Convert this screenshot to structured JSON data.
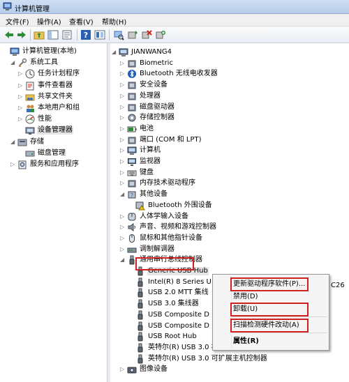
{
  "window": {
    "title": "计算机管理"
  },
  "menu": [
    "文件(F)",
    "操作(A)",
    "查看(V)",
    "帮助(H)"
  ],
  "left_tree": [
    {
      "label": "计算机管理(本地)",
      "icon": "computer-mgmt-icon",
      "arrow": "",
      "level": 0
    },
    {
      "label": "系统工具",
      "icon": "tools-icon",
      "arrow": "◢",
      "level": 1
    },
    {
      "label": "任务计划程序",
      "icon": "clock-icon",
      "arrow": "▷",
      "level": 2
    },
    {
      "label": "事件查看器",
      "icon": "event-viewer-icon",
      "arrow": "▷",
      "level": 2
    },
    {
      "label": "共享文件夹",
      "icon": "shared-folder-icon",
      "arrow": "▷",
      "level": 2
    },
    {
      "label": "本地用户和组",
      "icon": "users-icon",
      "arrow": "▷",
      "level": 2
    },
    {
      "label": "性能",
      "icon": "performance-icon",
      "arrow": "▷",
      "level": 2
    },
    {
      "label": "设备管理器",
      "icon": "device-manager-icon",
      "arrow": "",
      "level": 2,
      "selected": true
    },
    {
      "label": "存储",
      "icon": "storage-icon",
      "arrow": "◢",
      "level": 1
    },
    {
      "label": "磁盘管理",
      "icon": "disk-mgmt-icon",
      "arrow": "",
      "level": 2
    },
    {
      "label": "服务和应用程序",
      "icon": "services-icon",
      "arrow": "▷",
      "level": 1
    }
  ],
  "device_tree": [
    {
      "label": "JIANWANG4",
      "icon": "computer-icon",
      "arrow": "◢",
      "level": 0
    },
    {
      "label": "Biometric",
      "icon": "device-icon",
      "arrow": "▷",
      "level": 1
    },
    {
      "label": "Bluetooth 无线电收发器",
      "icon": "bluetooth-icon",
      "arrow": "▷",
      "level": 1
    },
    {
      "label": "安全设备",
      "icon": "device-icon",
      "arrow": "▷",
      "level": 1
    },
    {
      "label": "处理器",
      "icon": "device-icon",
      "arrow": "▷",
      "level": 1
    },
    {
      "label": "磁盘驱动器",
      "icon": "device-icon",
      "arrow": "▷",
      "level": 1
    },
    {
      "label": "存储控制器",
      "icon": "gear-icon",
      "arrow": "▷",
      "level": 1
    },
    {
      "label": "电池",
      "icon": "battery-icon",
      "arrow": "▷",
      "level": 1
    },
    {
      "label": "端口 (COM 和 LPT)",
      "icon": "device-icon",
      "arrow": "▷",
      "level": 1
    },
    {
      "label": "计算机",
      "icon": "computer-icon",
      "arrow": "▷",
      "level": 1
    },
    {
      "label": "监视器",
      "icon": "monitor-icon",
      "arrow": "▷",
      "level": 1
    },
    {
      "label": "键盘",
      "icon": "keyboard-icon",
      "arrow": "▷",
      "level": 1
    },
    {
      "label": "内存技术驱动程序",
      "icon": "device-icon",
      "arrow": "▷",
      "level": 1
    },
    {
      "label": "其他设备",
      "icon": "other-devices-icon",
      "arrow": "◢",
      "level": 1
    },
    {
      "label": "Bluetooth 外围设备",
      "icon": "warning-device-icon",
      "arrow": "",
      "level": 2
    },
    {
      "label": "人体学输入设备",
      "icon": "hid-icon",
      "arrow": "▷",
      "level": 1
    },
    {
      "label": "声音、视频和游戏控制器",
      "icon": "sound-icon",
      "arrow": "▷",
      "level": 1
    },
    {
      "label": "鼠标和其他指针设备",
      "icon": "mouse-icon",
      "arrow": "▷",
      "level": 1
    },
    {
      "label": "调制解调器",
      "icon": "modem-icon",
      "arrow": "▷",
      "level": 1
    },
    {
      "label": "通用串行总线控制器",
      "icon": "usb-icon",
      "arrow": "◢",
      "level": 1,
      "highlight": true
    },
    {
      "label": "Generic USB Hub",
      "icon": "usb-icon",
      "arrow": "",
      "level": 2,
      "selected": true
    },
    {
      "label": "Intel(R) 8 Series U",
      "icon": "usb-icon",
      "arrow": "",
      "level": 2
    },
    {
      "label": "USB 2.0 MTT 集线",
      "icon": "usb-icon",
      "arrow": "",
      "level": 2
    },
    {
      "label": "USB 3.0 集线器",
      "icon": "usb-icon",
      "arrow": "",
      "level": 2
    },
    {
      "label": "USB Composite D",
      "icon": "usb-icon",
      "arrow": "",
      "level": 2
    },
    {
      "label": "USB Composite D",
      "icon": "usb-icon",
      "arrow": "",
      "level": 2
    },
    {
      "label": "USB Root Hub",
      "icon": "usb-icon",
      "arrow": "",
      "level": 2
    },
    {
      "label": "英特尔(R) USB 3.0 根集线器",
      "icon": "usb-icon",
      "arrow": "",
      "level": 2
    },
    {
      "label": "英特尔(R) USB 3.0 可扩展主机控制器",
      "icon": "usb-icon",
      "arrow": "",
      "level": 2
    },
    {
      "label": "图像设备",
      "icon": "camera-icon",
      "arrow": "▷",
      "level": 1
    }
  ],
  "clipped_text": "C26",
  "context_menu": [
    {
      "label": "更新驱动程序软件(P)...",
      "highlight": true
    },
    {
      "label": "禁用(D)",
      "highlight": false
    },
    {
      "label": "卸载(U)",
      "highlight": true
    },
    {
      "label": "扫描检测硬件改动(A)",
      "highlight": true
    },
    {
      "label": "属性(R)",
      "highlight": false,
      "bold": true
    }
  ],
  "colors": {
    "highlight_box": "#d21f1f",
    "title_bar": "#c5d8ef"
  }
}
